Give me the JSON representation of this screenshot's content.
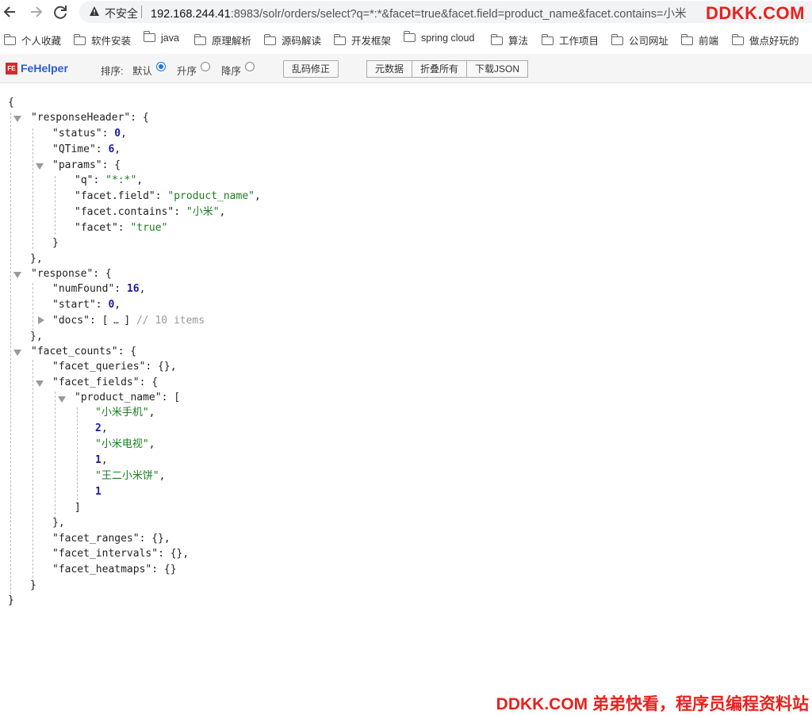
{
  "browser": {
    "security_label": "不安全",
    "url_host": "192.168.244.41",
    "url_rest": ":8983/solr/orders/select?q=*:*&facet=true&facet.field=product_name&facet.contains=小米",
    "watermark": "DDKK.COM"
  },
  "bookmarks": [
    "个人收藏",
    "软件安装",
    "java",
    "原理解析",
    "源码解读",
    "开发框架",
    "spring cloud",
    "算法",
    "工作项目",
    "公司网址",
    "前端",
    "做点好玩的"
  ],
  "fehelper": {
    "name": "FeHelper",
    "logo": "FE",
    "sort_label": "排序:",
    "sort_options": [
      "默认",
      "升序",
      "降序"
    ],
    "selected_sort": "默认",
    "fix_button": "乱码修正",
    "group_buttons": [
      "元数据",
      "折叠所有",
      "下载JSON"
    ]
  },
  "json": {
    "open_root": "{",
    "close_root": "}",
    "responseHeader_key": "\"responseHeader\"",
    "status_key": "\"status\"",
    "status_val": "0",
    "qtime_key": "\"QTime\"",
    "qtime_val": "6",
    "params_key": "\"params\"",
    "q_key": "\"q\"",
    "q_val": "\"*:*\"",
    "ff_key": "\"facet.field\"",
    "ff_val": "\"product_name\"",
    "fc_key": "\"facet.contains\"",
    "fc_val": "\"小米\"",
    "facet_key": "\"facet\"",
    "facet_val": "\"true\"",
    "response_key": "\"response\"",
    "numfound_key": "\"numFound\"",
    "numfound_val": "16",
    "start_key": "\"start\"",
    "start_val": "0",
    "docs_key": "\"docs\"",
    "docs_comment": "// 10 items",
    "facet_counts_key": "\"facet_counts\"",
    "facet_queries_key": "\"facet_queries\"",
    "facet_fields_key": "\"facet_fields\"",
    "product_name_key": "\"product_name\"",
    "pn_items": [
      "\"小米手机\"",
      "2",
      "\"小米电视\"",
      "1",
      "\"王二小米饼\"",
      "1"
    ],
    "facet_ranges_key": "\"facet_ranges\"",
    "facet_intervals_key": "\"facet_intervals\"",
    "facet_heatmaps_key": "\"facet_heatmaps\""
  },
  "footer": "DDKK.COM 弟弟快看，程序员编程资料站"
}
